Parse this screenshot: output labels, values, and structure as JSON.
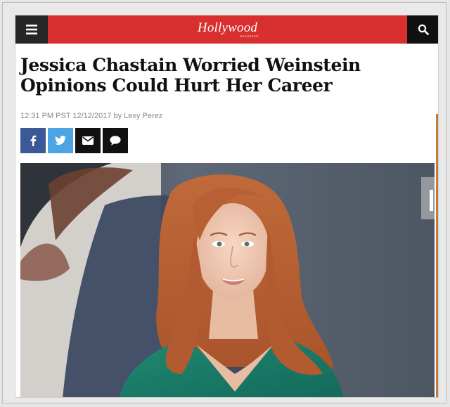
{
  "header": {
    "logo_text": "Hollywood",
    "logo_sub": "REPORTER",
    "accent_color": "#d92f2f",
    "menu_icon": "hamburger-menu-icon",
    "search_icon": "search-icon"
  },
  "article": {
    "headline": "Jessica Chastain Worried Weinstein Opinions Could Hurt Her Career",
    "byline": "12:31 PM PST 12/12/2017 by Lexy Perez"
  },
  "share": {
    "facebook_icon": "facebook-icon",
    "twitter_icon": "twitter-icon",
    "email_icon": "email-icon",
    "comment_icon": "comment-icon",
    "colors": {
      "facebook": "#3b5998",
      "twitter": "#4ca4e2",
      "email": "#111111",
      "comment": "#111111"
    }
  },
  "hero_image": {
    "alt": "Jessica Chastain"
  }
}
